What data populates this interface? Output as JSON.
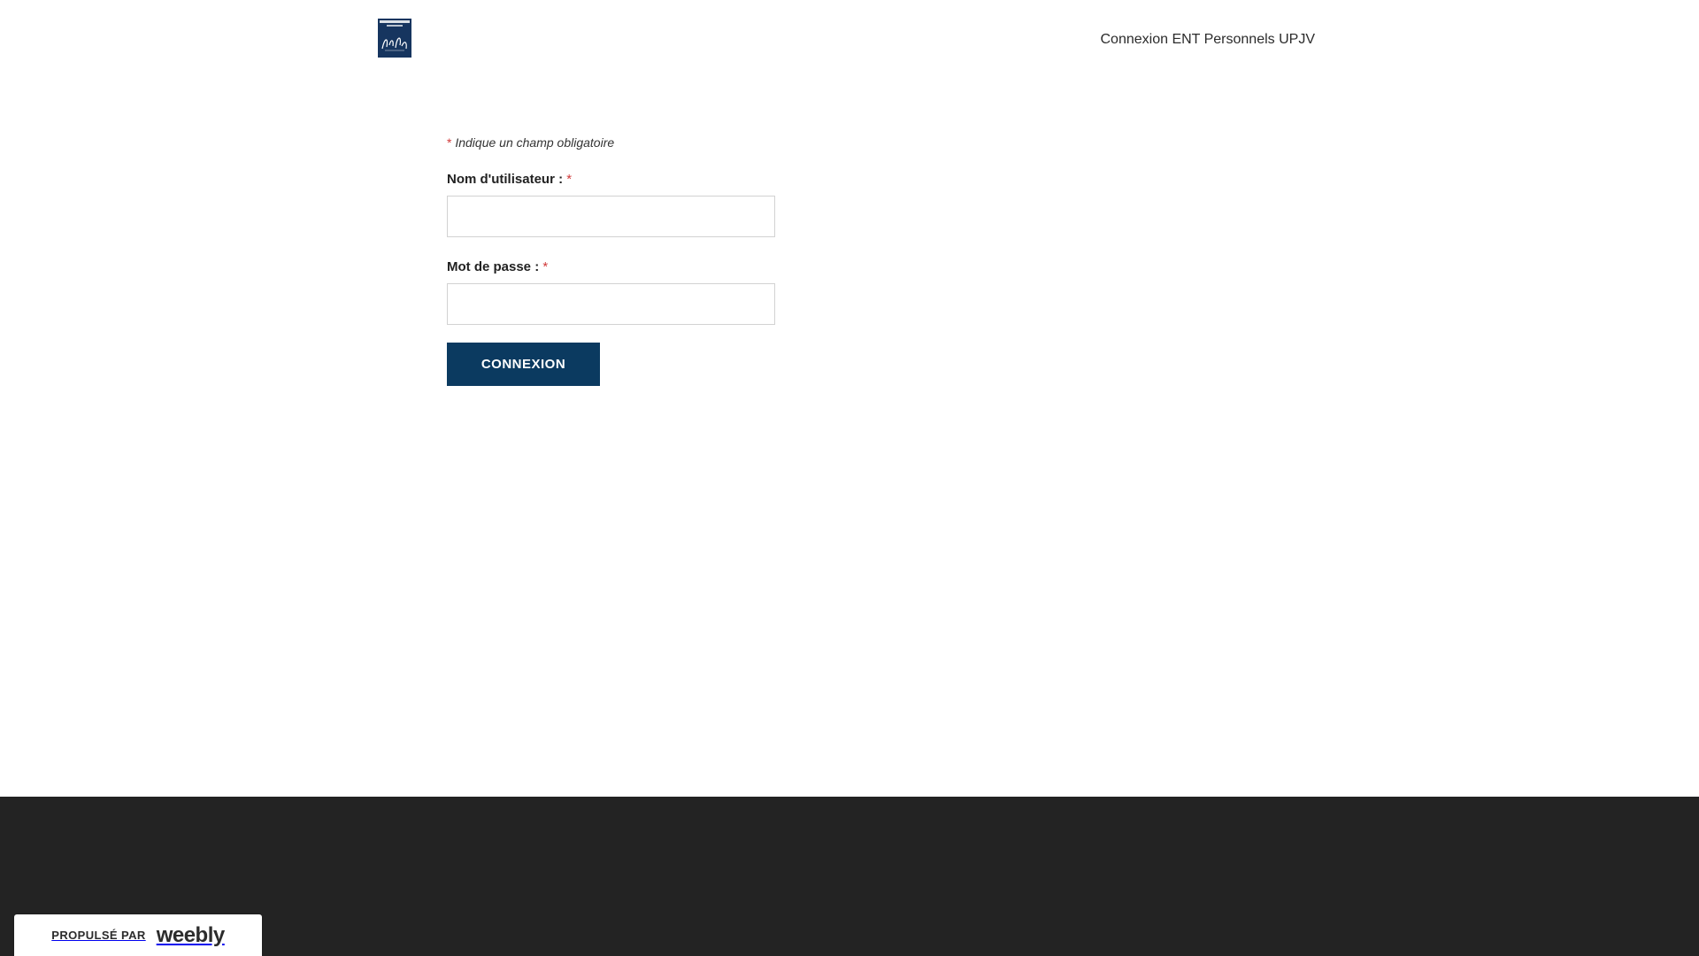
{
  "header": {
    "logo_text": "UNIVERSITÉ de Picardie Jules Verne",
    "nav_link": "Connexion ENT Personnels UPJV"
  },
  "form": {
    "required_note": "Indique un champ obligatoire",
    "asterisk": "*",
    "username_label": "Nom d'utilisateur :",
    "username_value": "",
    "password_label": "Mot de passe :",
    "password_value": "",
    "submit_label": "CONNEXION"
  },
  "badge": {
    "prefix": "PROPULSÉ PAR",
    "brand": "weebly"
  },
  "colors": {
    "button_bg": "#0b3a60",
    "footer_bg": "#232323",
    "required_asterisk": "#d13a3a",
    "logo_bg": "#16355f"
  }
}
